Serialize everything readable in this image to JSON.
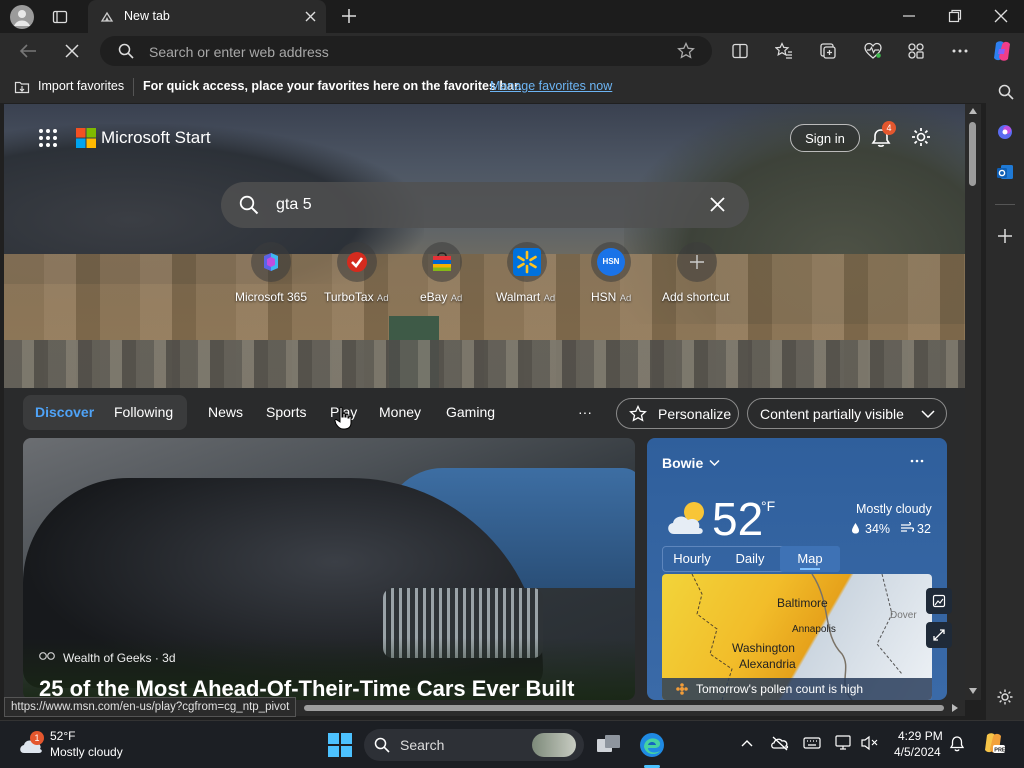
{
  "browser": {
    "tab_title": "New tab",
    "address_placeholder": "Search or enter web address"
  },
  "favorites_bar": {
    "import_label": "Import favorites",
    "message": "For quick access, place your favorites here on the favorites bar.",
    "manage_link": "Manage favorites now"
  },
  "header": {
    "brand": "Microsoft Start",
    "sign_in": "Sign in",
    "notification_count": "4"
  },
  "search": {
    "value": "gta 5"
  },
  "shortcuts": [
    {
      "label": "Microsoft 365",
      "ad": ""
    },
    {
      "label": "TurboTax",
      "ad": "Ad"
    },
    {
      "label": "eBay",
      "ad": "Ad"
    },
    {
      "label": "Walmart",
      "ad": "Ad"
    },
    {
      "label": "HSN",
      "ad": "Ad"
    },
    {
      "label": "Add shortcut",
      "ad": ""
    }
  ],
  "feed_nav": {
    "discover": "Discover",
    "following": "Following",
    "news": "News",
    "sports": "Sports",
    "play": "Play",
    "money": "Money",
    "gaming": "Gaming",
    "more": "···",
    "personalize": "Personalize",
    "content_visibility": "Content partially visible"
  },
  "hero_article": {
    "source": "Wealth of Geeks · 3d",
    "headline": "25 of the Most Ahead-Of-Their-Time Cars Ever Built"
  },
  "weather_card": {
    "location": "Bowie",
    "temperature": "52",
    "unit": "°F",
    "condition": "Mostly cloudy",
    "humidity": "34%",
    "wind": "32",
    "tabs": [
      "Hourly",
      "Daily",
      "Map"
    ],
    "active_tab": "Map",
    "map_labels": [
      "Baltimore",
      "Annapolis",
      "Washington",
      "Alexandria",
      "Dover"
    ],
    "pollen_note": "Tomorrow's pollen count is high"
  },
  "status_url": "https://www.msn.com/en-us/play?cgfrom=cg_ntp_pivot",
  "taskbar": {
    "weather_temp": "52°F",
    "weather_text": "Mostly cloudy",
    "weather_badge": "1",
    "search_label": "Search",
    "time": "4:29 PM",
    "date": "4/5/2024"
  },
  "colors": {
    "accent_link": "#6cb4f3",
    "discover_blue": "#4fa3f7",
    "notification_badge": "#e4572e",
    "weather_card_bg": "#2f5f9c"
  }
}
